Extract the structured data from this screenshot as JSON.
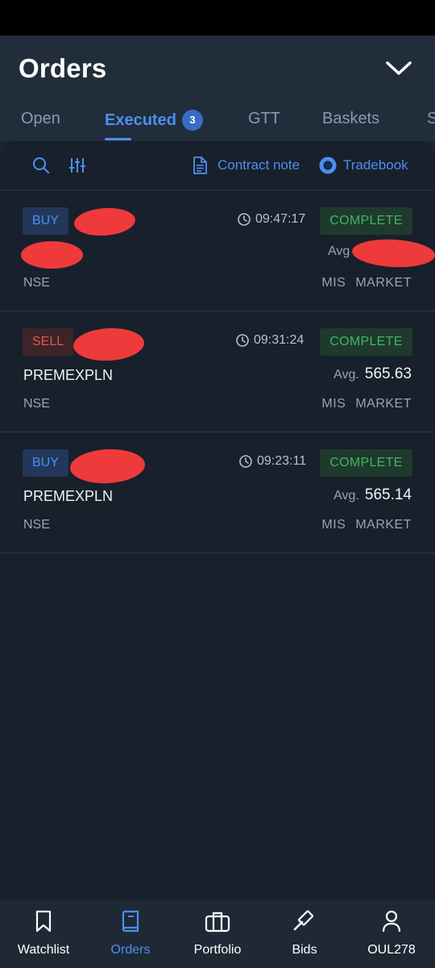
{
  "header": {
    "title": "Orders",
    "tabs": [
      {
        "label": "Open"
      },
      {
        "label": "Executed",
        "badge": "3"
      },
      {
        "label": "GTT"
      },
      {
        "label": "Baskets"
      },
      {
        "label": "S"
      }
    ]
  },
  "toolbar": {
    "contract_note_label": "Contract note",
    "tradebook_label": "Tradebook"
  },
  "orders": [
    {
      "side": "BUY",
      "time": "09:47:17",
      "status": "COMPLETE",
      "symbol": "",
      "avg_label": "Avg",
      "avg_value": "",
      "exchange": "NSE",
      "product": "MIS",
      "order_type": "MARKET"
    },
    {
      "side": "SELL",
      "time": "09:31:24",
      "status": "COMPLETE",
      "symbol": "PREMEXPLN",
      "avg_label": "Avg.",
      "avg_value": "565.63",
      "exchange": "NSE",
      "product": "MIS",
      "order_type": "MARKET"
    },
    {
      "side": "BUY",
      "time": "09:23:11",
      "status": "COMPLETE",
      "symbol": "PREMEXPLN",
      "avg_label": "Avg.",
      "avg_value": "565.14",
      "exchange": "NSE",
      "product": "MIS",
      "order_type": "MARKET"
    }
  ],
  "bottom_nav": [
    {
      "label": "Watchlist",
      "icon": "bookmark-icon"
    },
    {
      "label": "Orders",
      "icon": "book-icon"
    },
    {
      "label": "Portfolio",
      "icon": "briefcase-icon"
    },
    {
      "label": "Bids",
      "icon": "gavel-icon"
    },
    {
      "label": "OUL278",
      "icon": "user-icon"
    }
  ],
  "colors": {
    "accent": "#4c8ff2",
    "buy": "#4c8ff2",
    "sell": "#e0574f",
    "complete": "#3fb563",
    "background": "#18202b",
    "header": "#212d3b"
  }
}
